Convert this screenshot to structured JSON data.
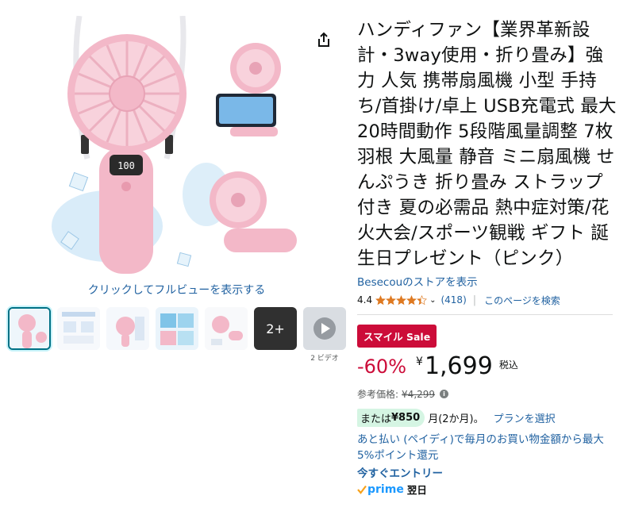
{
  "gallery": {
    "fullview_link": "クリックしてフルビューを表示する",
    "more_count": "2+",
    "video_caption": "2 ビデオ",
    "display_readout": "100"
  },
  "product": {
    "title": "ハンディファン【業界革新設計・3way使用・折り畳み】強力 人気 携帯扇風機 小型 手持ち/首掛け/卓上 USB充電式 最大20時間動作 5段階風量調整 7枚羽根 大風量 静音 ミニ扇風機 せんぷうき 折り畳み ストラップ付き 夏の必需品 熱中症対策/花火大会/スポーツ観戦 ギフト 誕生日プレゼント（ピンク）",
    "store_link": "Besecouのストアを表示",
    "rating_value": "4.4",
    "rating_count": "(418)",
    "separator": "|",
    "search_page_link": "このページを検索"
  },
  "pricing": {
    "sale_badge": "スマイル Sale",
    "discount": "-60%",
    "currency": "¥",
    "price": "1,699",
    "tax_label": "税込",
    "reference_label": "参考価格:",
    "reference_price": "¥4,299",
    "installment_prefix": "または",
    "installment_amount": "¥850",
    "installment_suffix": "月(2か月)。",
    "plan_link": "プランを選択",
    "atobarai_text": "あと払い (ペイディ)で毎月のお買い物金額から最大5%ポイント還元",
    "entry_link": "今すぐエントリー",
    "prime_label": "prime",
    "delivery_label": "翌日"
  },
  "colors": {
    "link": "#2162a1",
    "sale_red": "#cc0c39",
    "star": "#de7921",
    "prime_blue": "#1a98ff",
    "install_green": "#d5f5e3",
    "product_pink": "#f3b8c8"
  },
  "icons": {
    "share": "share-icon",
    "star": "star-icon",
    "info": "info-icon",
    "prime_check": "prime-check-icon",
    "play": "play-icon"
  }
}
